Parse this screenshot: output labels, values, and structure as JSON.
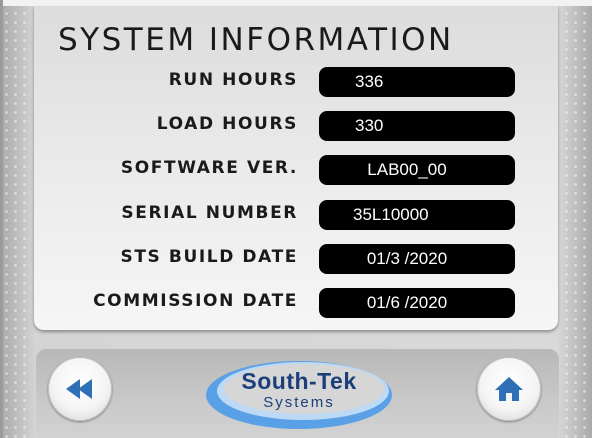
{
  "screen": {
    "title": "SYSTEM INFORMATION",
    "rows": [
      {
        "label": "RUN HOURS",
        "value": "336"
      },
      {
        "label": "LOAD HOURS",
        "value": "330"
      },
      {
        "label": "SOFTWARE VER.",
        "value": "LAB00_00"
      },
      {
        "label": "SERIAL NUMBER",
        "value": "35L10000"
      },
      {
        "label": "STS BUILD DATE",
        "value": "01/3 /2020"
      },
      {
        "label": "COMMISSION DATE",
        "value": "01/6 /2020"
      }
    ]
  },
  "footer": {
    "back_icon": "rewind-icon",
    "home_icon": "home-icon",
    "logo": {
      "main": "South-Tek",
      "sub": "Systems"
    }
  },
  "colors": {
    "value_bg": "#000000",
    "value_text": "#ffffff",
    "icon_blue": "#2f6fb6",
    "logo_blue": "#1c3f7a",
    "logo_swoosh": "#5aa0e6"
  }
}
